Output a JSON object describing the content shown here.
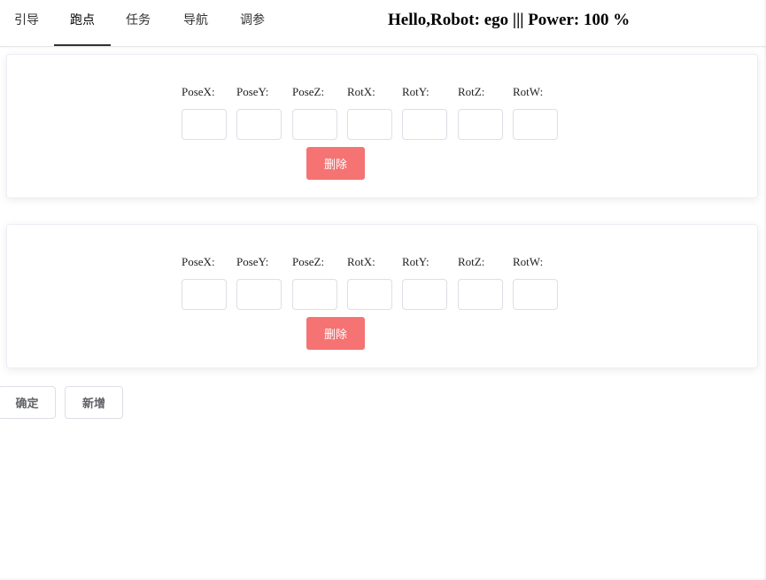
{
  "nav": {
    "tabs": [
      {
        "label": "引导"
      },
      {
        "label": "跑点"
      },
      {
        "label": "任务"
      },
      {
        "label": "导航"
      },
      {
        "label": "调参"
      }
    ],
    "active_tab": "跑点"
  },
  "header": {
    "status": "Hello,Robot: ego ||| Power: 100 %"
  },
  "cards": [
    {
      "labels": [
        "PoseX:",
        "PoseY:",
        "PoseZ:",
        "RotX:",
        "RotY:",
        "RotZ:",
        "RotW:"
      ],
      "values": [
        "",
        "",
        "",
        "",
        "",
        "",
        ""
      ],
      "delete_label": "删除"
    },
    {
      "labels": [
        "PoseX:",
        "PoseY:",
        "PoseZ:",
        "RotX:",
        "RotY:",
        "RotZ:",
        "RotW:"
      ],
      "values": [
        "",
        "",
        "",
        "",
        "",
        "",
        ""
      ],
      "delete_label": "删除"
    }
  ],
  "actions": {
    "confirm_label": "确定",
    "add_label": "新增"
  },
  "colors": {
    "danger": "#f56c6c",
    "border": "#dcdfe6"
  }
}
